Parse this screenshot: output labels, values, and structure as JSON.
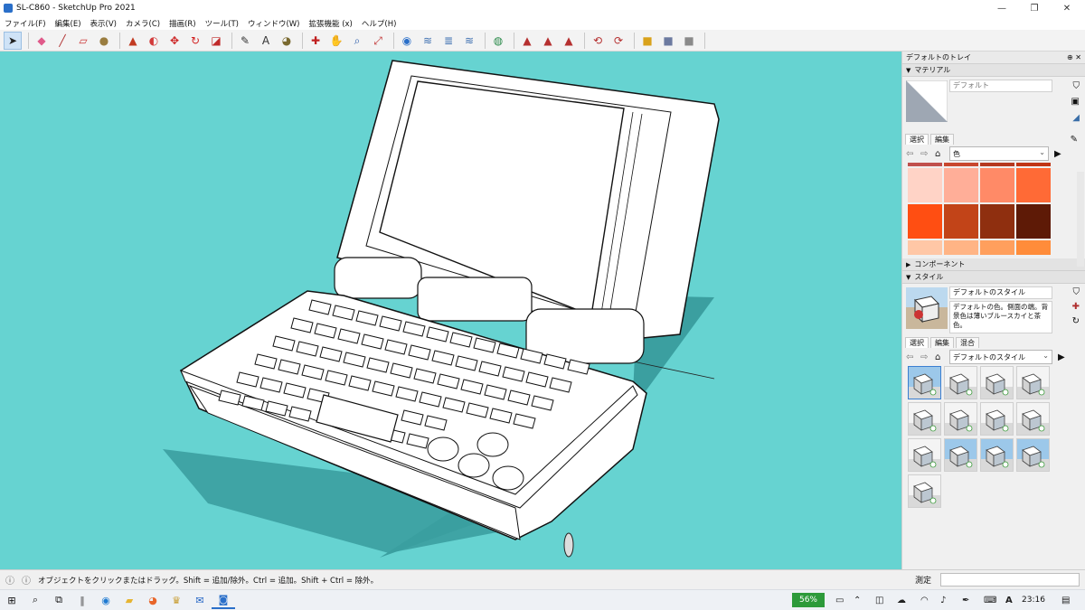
{
  "window": {
    "title": "SL-C860 - SketchUp Pro 2021",
    "controls": [
      "—",
      "❐",
      "✕"
    ]
  },
  "menu": [
    "ファイル(F)",
    "編集(E)",
    "表示(V)",
    "カメラ(C)",
    "描画(R)",
    "ツール(T)",
    "ウィンドウ(W)",
    "拡張機能 (x)",
    "ヘルプ(H)"
  ],
  "toolbar": {
    "groups": [
      [
        {
          "icon": "select-arrow-icon",
          "glyph": "➤",
          "color": "#222"
        }
      ],
      [
        {
          "icon": "eraser-icon",
          "glyph": "◆",
          "color": "#e05a8a"
        },
        {
          "icon": "pencil-icon",
          "glyph": "╱",
          "color": "#b03030"
        },
        {
          "icon": "shapes-icon",
          "glyph": "▱",
          "color": "#cc3333"
        },
        {
          "icon": "paint-bucket-icon",
          "glyph": "●",
          "color": "#9a7d40"
        }
      ],
      [
        {
          "icon": "push-pull-icon",
          "glyph": "▲",
          "color": "#c23b22"
        },
        {
          "icon": "follow-me-icon",
          "glyph": "◐",
          "color": "#d23b3b"
        },
        {
          "icon": "move-icon",
          "glyph": "✥",
          "color": "#cc2222"
        },
        {
          "icon": "rotate-icon",
          "glyph": "↻",
          "color": "#d22222"
        },
        {
          "icon": "scale-icon",
          "glyph": "◪",
          "color": "#c02a2a"
        }
      ],
      [
        {
          "icon": "tape-measure-icon",
          "glyph": "✎",
          "color": "#333"
        },
        {
          "icon": "text-icon",
          "glyph": "A",
          "color": "#333"
        },
        {
          "icon": "paint-icon",
          "glyph": "◕",
          "color": "#7a6a30"
        }
      ],
      [
        {
          "icon": "orbit-icon",
          "glyph": "✚",
          "color": "#c02020"
        },
        {
          "icon": "pan-icon",
          "glyph": "✋",
          "color": "#b08040"
        },
        {
          "icon": "zoom-icon",
          "glyph": "⌕",
          "color": "#2a5caa"
        },
        {
          "icon": "zoom-extents-icon",
          "glyph": "⤢",
          "color": "#c03030"
        }
      ],
      [
        {
          "icon": "warehouse-icon",
          "glyph": "◉",
          "color": "#2a6fc9"
        },
        {
          "icon": "extension-icon",
          "glyph": "≋",
          "color": "#3d6fb0"
        },
        {
          "icon": "layout-icon",
          "glyph": "≣",
          "color": "#3d6fb0"
        },
        {
          "icon": "trimble-icon",
          "glyph": "≋",
          "color": "#3d6fb0"
        }
      ],
      [
        {
          "icon": "account-icon",
          "glyph": "◍",
          "color": "#2a8a4a"
        }
      ],
      [
        {
          "icon": "sandbox-icon-1",
          "glyph": "▲",
          "color": "#b53030"
        },
        {
          "icon": "sandbox-icon-2",
          "glyph": "▲",
          "color": "#b53030"
        },
        {
          "icon": "sandbox-icon-3",
          "glyph": "▲",
          "color": "#b53030"
        }
      ],
      [
        {
          "icon": "section-plane-icon",
          "glyph": "⟲",
          "color": "#b53030"
        },
        {
          "icon": "section-display-icon",
          "glyph": "⟳",
          "color": "#b53030"
        }
      ],
      [
        {
          "icon": "component-icon-1",
          "glyph": "■",
          "color": "#d9a21b"
        },
        {
          "icon": "component-icon-2",
          "glyph": "■",
          "color": "#6c7aa0"
        },
        {
          "icon": "component-icon-3",
          "glyph": "■",
          "color": "#8a8a8a"
        }
      ]
    ]
  },
  "tray": {
    "title": "デフォルトのトレイ",
    "pin": "⊕ ✕",
    "materials": {
      "header": "マテリアル",
      "name": "デフォルト",
      "tabs": [
        "選択",
        "編集"
      ],
      "combo": "色",
      "swatches": [
        "#c0504d",
        "#c8472e",
        "#b5381f",
        "#c03515",
        "#ffd3c6",
        "#ffae98",
        "#ff8a67",
        "#ff6a36",
        "#ff4e12",
        "#c24418",
        "#8f2f0f",
        "#5e1a06",
        "#ffc7a6",
        "#ffb485",
        "#ff9f5d",
        "#ff8c3a"
      ]
    },
    "components": {
      "header": "コンポーネント"
    },
    "styles": {
      "header": "スタイル",
      "name": "デフォルトのスタイル",
      "description": "デフォルトの色。側面の端。背景色は薄いブルースカイと茶色。",
      "tabs": [
        "選択",
        "編集",
        "混合"
      ],
      "combo": "デフォルトのスタイル",
      "thumbs": 13
    }
  },
  "status": {
    "hint": "オブジェクトをクリックまたはドラッグ。Shift = 追加/除外。Ctrl = 追加。Shift + Ctrl = 除外。",
    "measure_label": "測定",
    "measure_value": ""
  },
  "taskbar": {
    "battery": "56%",
    "time": "23:16",
    "ime": "A"
  }
}
